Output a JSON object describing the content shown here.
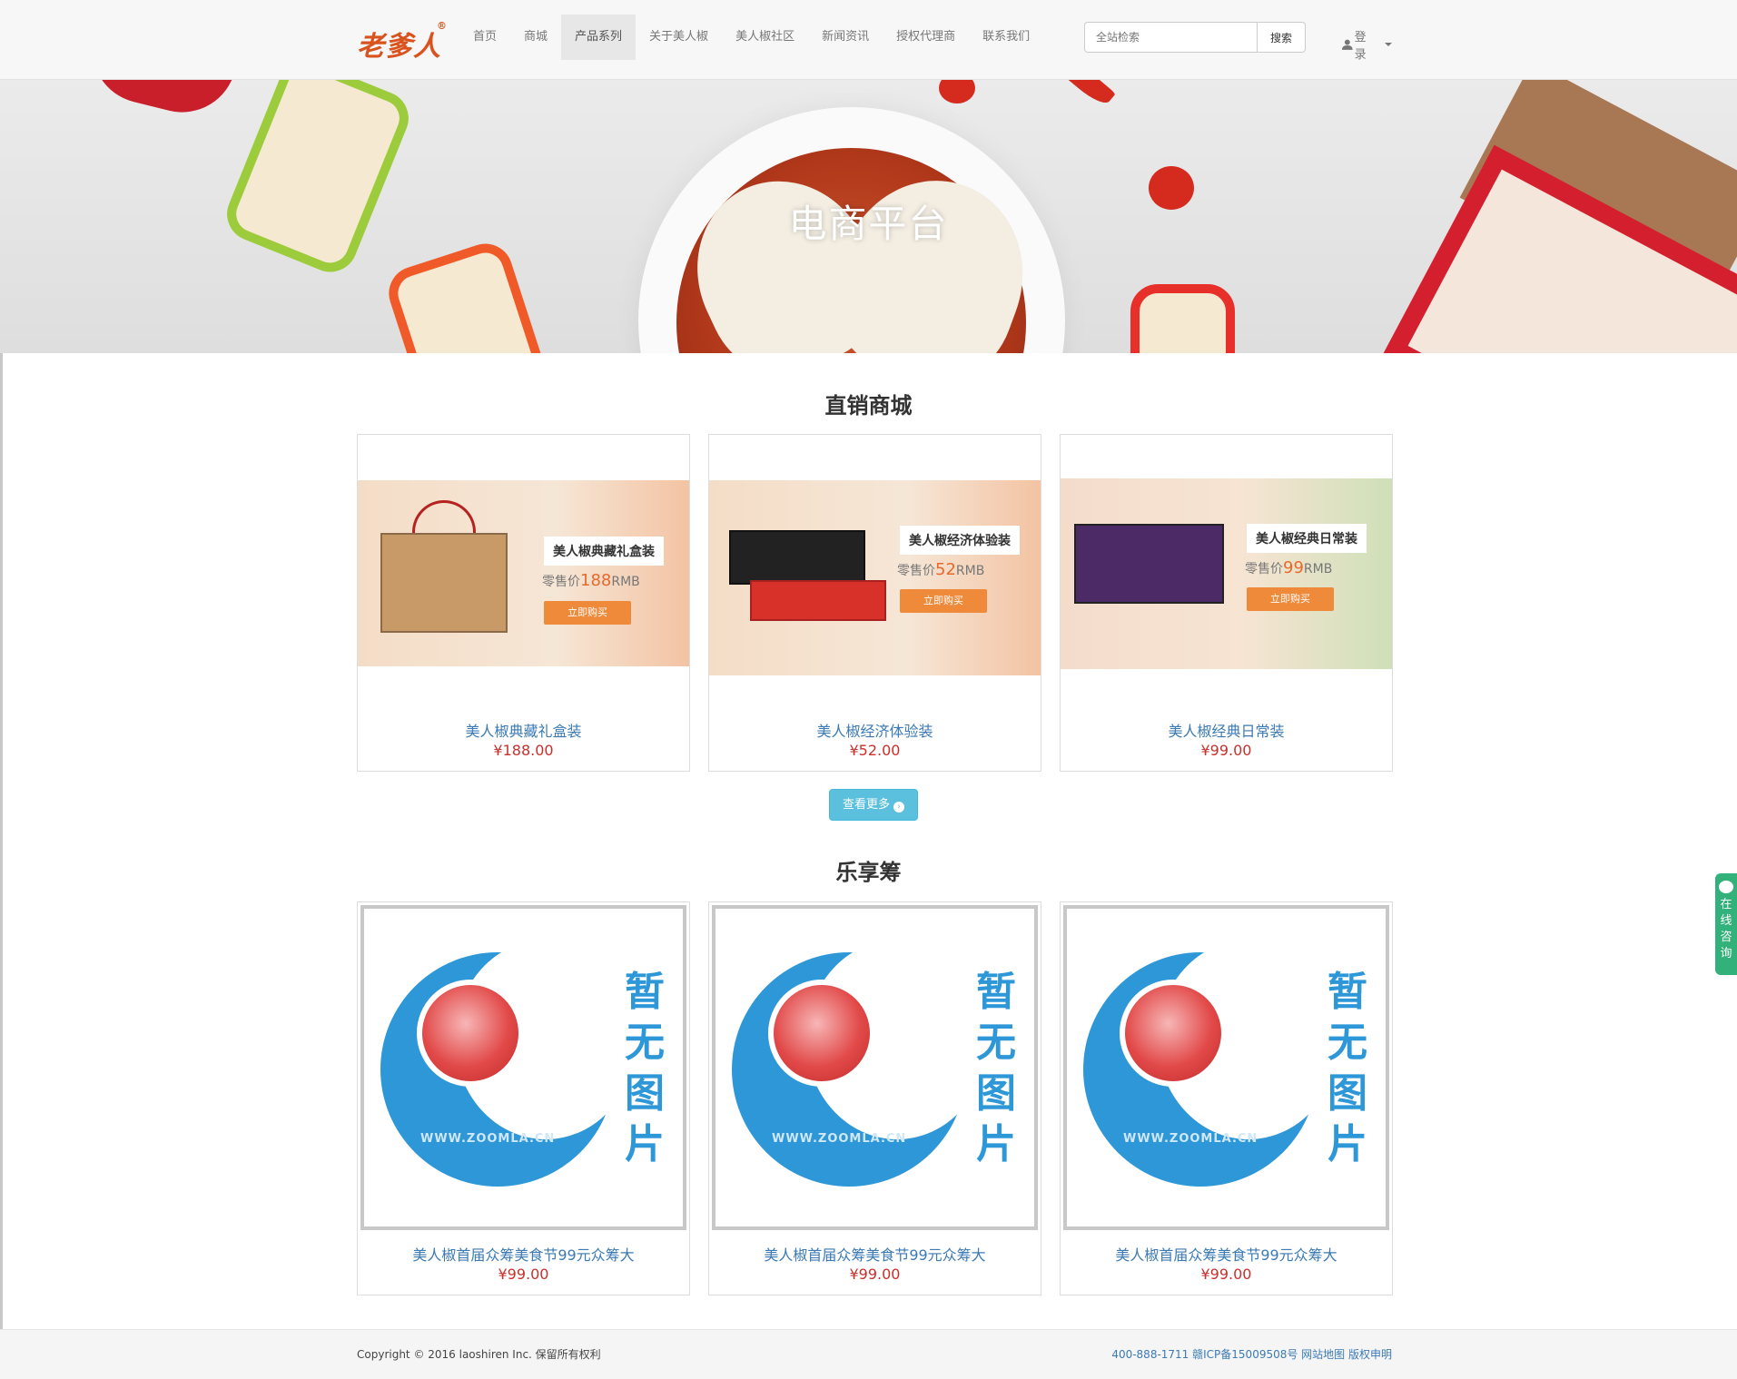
{
  "header": {
    "logo_text": "老爹人",
    "logo_mark": "®",
    "nav": [
      {
        "label": "首页"
      },
      {
        "label": "商城"
      },
      {
        "label": "产品系列",
        "active": true
      },
      {
        "label": "关于美人椒"
      },
      {
        "label": "美人椒社区"
      },
      {
        "label": "新闻资讯"
      },
      {
        "label": "授权代理商"
      },
      {
        "label": "联系我们"
      }
    ],
    "search": {
      "placeholder": "全站检索",
      "button": "搜索"
    },
    "login": "登录"
  },
  "banner": {
    "title": "电商平台"
  },
  "direct_shop": {
    "title": "直销商城",
    "products": [
      {
        "name": "美人椒典藏礼盒装",
        "price": "¥188.00",
        "promo_title": "美人椒典藏礼盒装",
        "promo_price_label": "零售价",
        "promo_price": "188",
        "promo_unit": "RMB",
        "promo_button": "立即购买"
      },
      {
        "name": "美人椒经济体验装",
        "price": "¥52.00",
        "promo_title": "美人椒经济体验装",
        "promo_price_label": "零售价",
        "promo_price": "52",
        "promo_unit": "RMB",
        "promo_button": "立即购买"
      },
      {
        "name": "美人椒经典日常装",
        "price": "¥99.00",
        "promo_title": "美人椒经典日常装",
        "promo_price_label": "零售价",
        "promo_price": "99",
        "promo_unit": "RMB",
        "promo_button": "立即购买"
      }
    ],
    "more_button": "查看更多"
  },
  "crowdfunding": {
    "title": "乐享筹",
    "placeholder_text": "暂无图片",
    "placeholder_url": "WWW.ZOOMLA.CN",
    "items": [
      {
        "name": "美人椒首届众筹美食节99元众筹大",
        "price": "¥99.00"
      },
      {
        "name": "美人椒首届众筹美食节99元众筹大",
        "price": "¥99.00"
      },
      {
        "name": "美人椒首届众筹美食节99元众筹大",
        "price": "¥99.00"
      }
    ]
  },
  "footer": {
    "copyright": "Copyright © 2016 laoshiren Inc. 保留所有权利",
    "links": "400-888-1711 赣ICP备15009508号 网站地图 版权申明"
  },
  "side_chat": {
    "label": "在线咨询"
  },
  "colors": {
    "accent": "#5bc0de",
    "link": "#3b7ab4",
    "price": "#c9302c",
    "chat": "#33b17a"
  }
}
